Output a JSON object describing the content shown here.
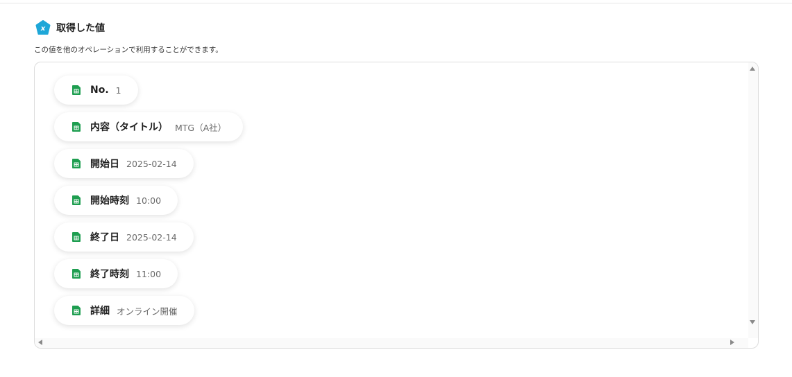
{
  "header": {
    "title": "取得した値",
    "description": "この値を他のオペレーションで利用することができます。"
  },
  "values": [
    {
      "label": "No.",
      "value": "1"
    },
    {
      "label": "内容（タイトル）",
      "value": "MTG（A社）"
    },
    {
      "label": "開始日",
      "value": "2025-02-14"
    },
    {
      "label": "開始時刻",
      "value": "10:00"
    },
    {
      "label": "終了日",
      "value": "2025-02-14"
    },
    {
      "label": "終了時刻",
      "value": "11:00"
    },
    {
      "label": "詳細",
      "value": "オンライン開催"
    }
  ],
  "colors": {
    "badge": "#1ea7d8",
    "sheet_green": "#1e9e50"
  },
  "icons": {
    "header": "variable-badge-icon",
    "chip": "spreadsheet-icon"
  }
}
